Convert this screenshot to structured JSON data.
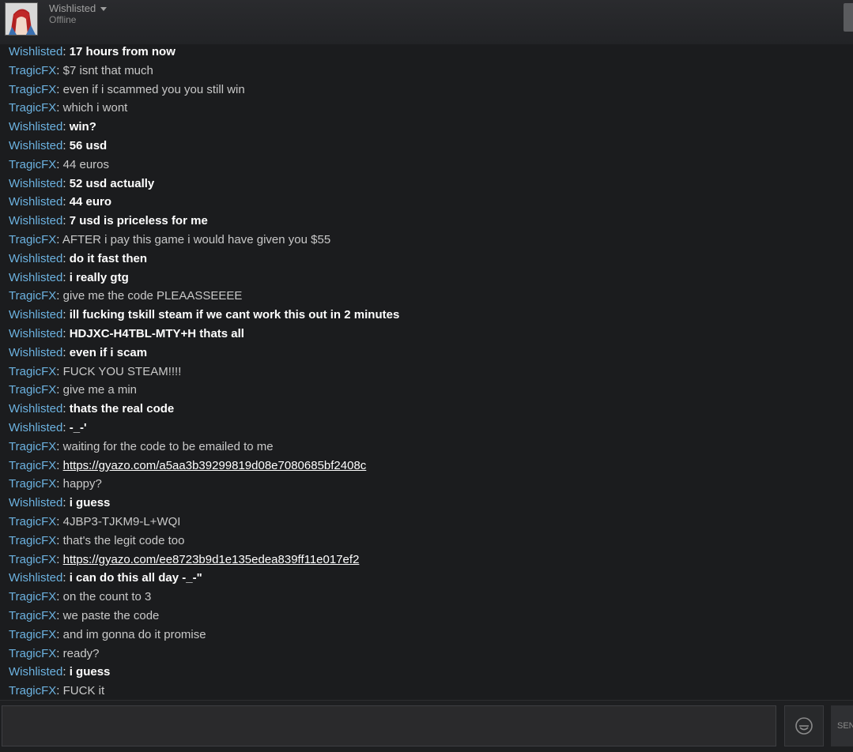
{
  "header": {
    "name": "Wishlisted",
    "status": "Offline"
  },
  "footer": {
    "send_label": "SEND",
    "emoticon_icon": "smiley-icon"
  },
  "messages": [
    {
      "sender": "Wishlisted",
      "text": "17 hours from now",
      "link": false
    },
    {
      "sender": "TragicFX",
      "text": "$7 isnt that much",
      "link": false
    },
    {
      "sender": "TragicFX",
      "text": "even if i scammed you you still win",
      "link": false
    },
    {
      "sender": "TragicFX",
      "text": "which i wont",
      "link": false
    },
    {
      "sender": "Wishlisted",
      "text": "win?",
      "link": false
    },
    {
      "sender": "Wishlisted",
      "text": "56 usd",
      "link": false
    },
    {
      "sender": "TragicFX",
      "text": "44 euros",
      "link": false
    },
    {
      "sender": "Wishlisted",
      "text": "52 usd actually",
      "link": false
    },
    {
      "sender": "Wishlisted",
      "text": "44 euro",
      "link": false
    },
    {
      "sender": "Wishlisted",
      "text": "7 usd is priceless for me",
      "link": false
    },
    {
      "sender": "TragicFX",
      "text": "AFTER i pay this game i would have given you $55",
      "link": false
    },
    {
      "sender": "Wishlisted",
      "text": "do it fast then",
      "link": false
    },
    {
      "sender": "Wishlisted",
      "text": "i really gtg",
      "link": false
    },
    {
      "sender": "TragicFX",
      "text": "give me the code PLEAASSEEEE",
      "link": false
    },
    {
      "sender": "Wishlisted",
      "text": "ill fucking tskill steam if we cant work this out in 2 minutes",
      "link": false
    },
    {
      "sender": "Wishlisted",
      "text": "HDJXC-H4TBL-MTY+H thats all",
      "link": false
    },
    {
      "sender": "Wishlisted",
      "text": "even if i scam",
      "link": false
    },
    {
      "sender": "TragicFX",
      "text": "FUCK YOU STEAM!!!!",
      "link": false
    },
    {
      "sender": "TragicFX",
      "text": "give me a min",
      "link": false
    },
    {
      "sender": "Wishlisted",
      "text": "thats the real code",
      "link": false
    },
    {
      "sender": "Wishlisted",
      "text": "-_-'",
      "link": false
    },
    {
      "sender": "TragicFX",
      "text": "waiting for the code to be emailed to me",
      "link": false
    },
    {
      "sender": "TragicFX",
      "text": "https://gyazo.com/a5aa3b39299819d08e7080685bf2408c",
      "link": true
    },
    {
      "sender": "TragicFX",
      "text": "happy?",
      "link": false
    },
    {
      "sender": "Wishlisted",
      "text": "i guess",
      "link": false
    },
    {
      "sender": "TragicFX",
      "text": "4JBP3-TJKM9-L+WQI",
      "link": false
    },
    {
      "sender": "TragicFX",
      "text": "that's the legit code too",
      "link": false
    },
    {
      "sender": "TragicFX",
      "text": "https://gyazo.com/ee8723b9d1e135edea839ff11e017ef2",
      "link": true
    },
    {
      "sender": "Wishlisted",
      "text": "i can do this all day -_-\"",
      "link": false
    },
    {
      "sender": "TragicFX",
      "text": "on the count to 3",
      "link": false
    },
    {
      "sender": "TragicFX",
      "text": "we paste the code",
      "link": false
    },
    {
      "sender": "TragicFX",
      "text": "and im gonna do it promise",
      "link": false
    },
    {
      "sender": "TragicFX",
      "text": "ready?",
      "link": false
    },
    {
      "sender": "Wishlisted",
      "text": "i guess",
      "link": false
    },
    {
      "sender": "TragicFX",
      "text": "FUCK it",
      "link": false
    }
  ]
}
